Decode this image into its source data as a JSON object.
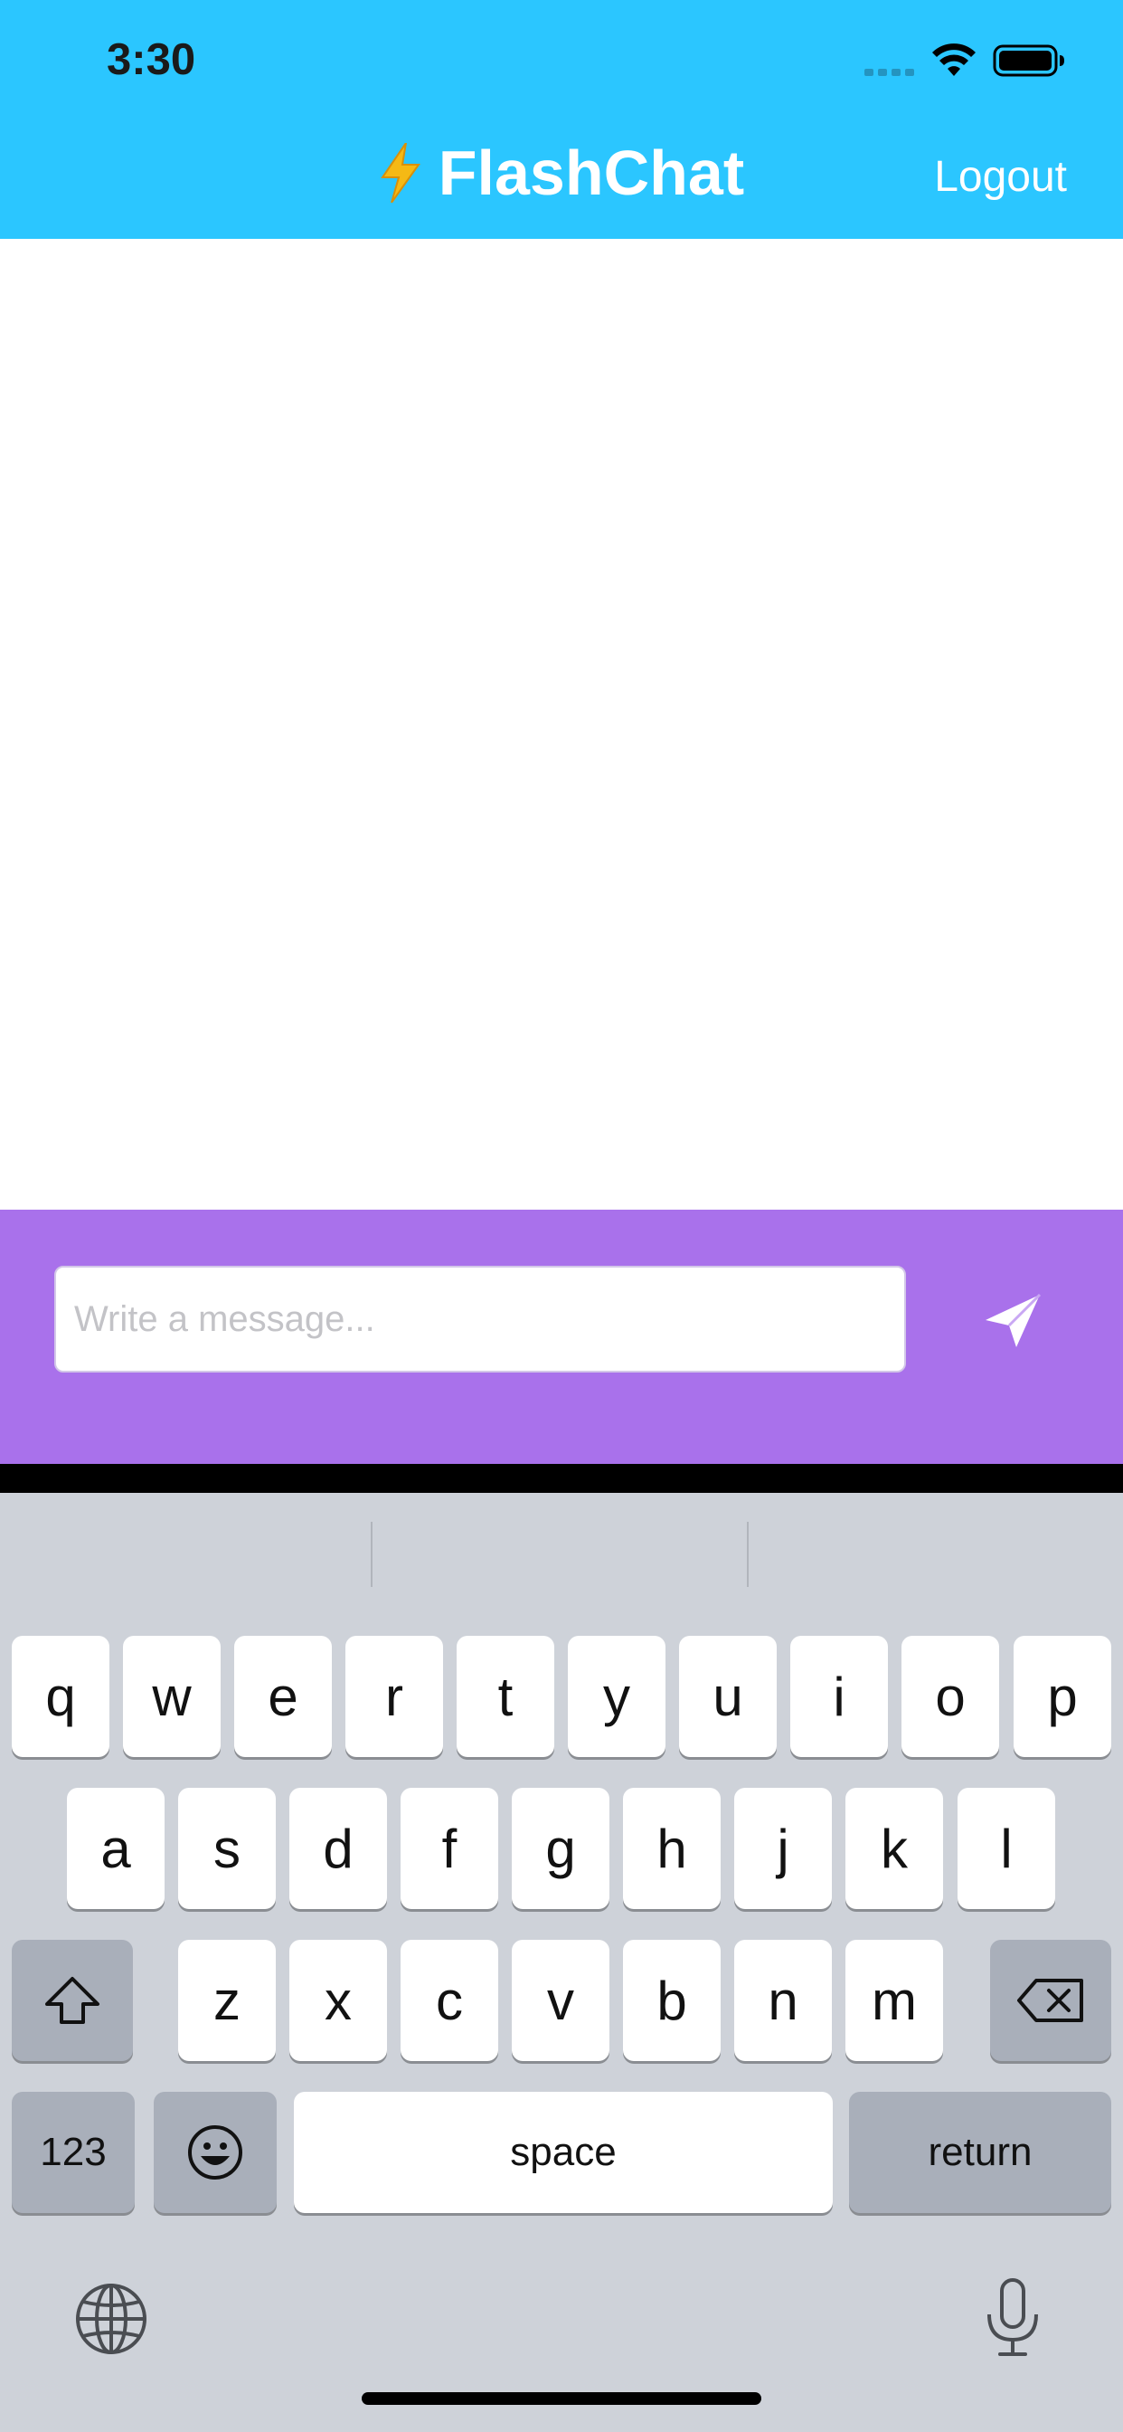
{
  "status_bar": {
    "time": "3:30"
  },
  "header": {
    "title": "FlashChat",
    "logout_label": "Logout"
  },
  "composer": {
    "placeholder": "Write a message...",
    "value": ""
  },
  "keyboard": {
    "row1": [
      "q",
      "w",
      "e",
      "r",
      "t",
      "y",
      "u",
      "i",
      "o",
      "p"
    ],
    "row2": [
      "a",
      "s",
      "d",
      "f",
      "g",
      "h",
      "j",
      "k",
      "l"
    ],
    "row3": [
      "z",
      "x",
      "c",
      "v",
      "b",
      "n",
      "m"
    ],
    "numbers_label": "123",
    "space_label": "space",
    "return_label": "return"
  },
  "colors": {
    "header_bg": "#2bc6ff",
    "composer_bg": "#a971eb",
    "keyboard_bg": "#ced2d9"
  },
  "icons": [
    "lightning-bolt-icon",
    "send-icon",
    "shift-icon",
    "delete-icon",
    "emoji-icon",
    "globe-icon",
    "microphone-icon",
    "wifi-icon",
    "battery-icon"
  ]
}
